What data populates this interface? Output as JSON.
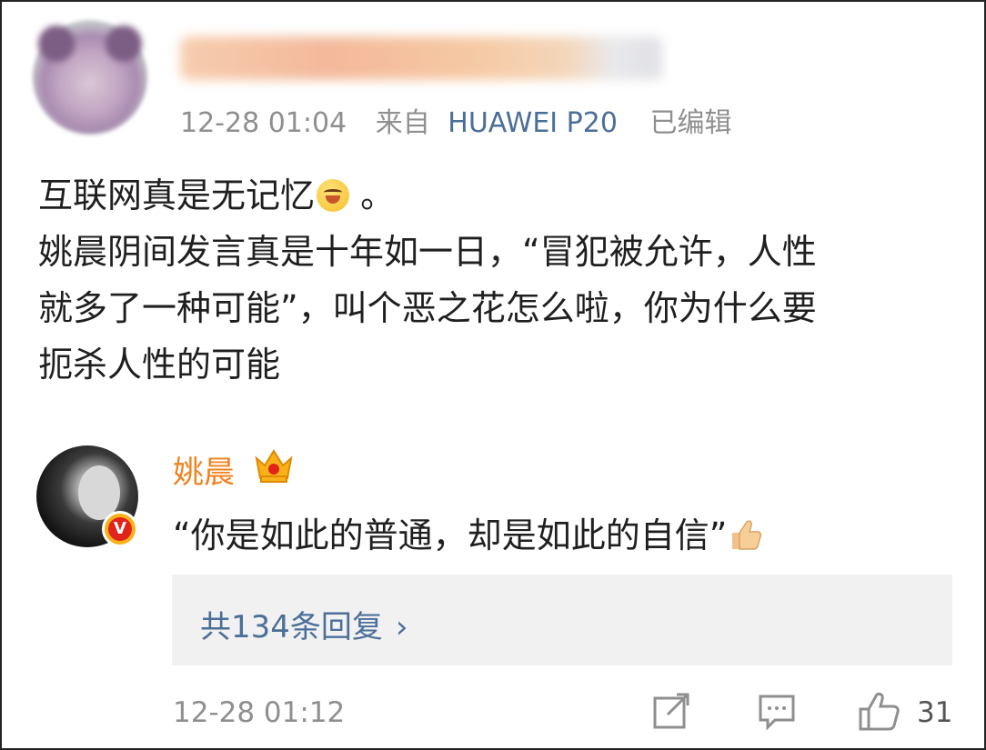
{
  "post": {
    "time": "12-28 01:04",
    "source_prefix": "来自",
    "device": "HUAWEI P20",
    "edited": "已编辑",
    "line1": "互联网真是无记忆",
    "line1_after_emoji": " 。",
    "line2": "姚晨阴间发言真是十年如一日，“冒犯被允许，人性",
    "line3": "就多了一种可能”，叫个恶之花怎么啦，你为什么要",
    "line4": "扼杀人性的可能"
  },
  "reply": {
    "name": "姚晨",
    "badge": "V",
    "text": "“你是如此的普通，却是如此的自信”",
    "replies_link": "共134条回复",
    "chevron": "›",
    "time": "12-28 01:12",
    "like_count": "31"
  },
  "icons": {
    "emoji": "grinning-face-icon",
    "crown": "crown-icon",
    "thumb": "thumbs-up-icon",
    "share": "share-icon",
    "comment": "comment-icon",
    "like": "like-icon"
  },
  "colors": {
    "link": "#4b6f99",
    "name": "#f0821e",
    "meta": "#8f8f8f",
    "reply_bg": "#f1f1f1"
  }
}
